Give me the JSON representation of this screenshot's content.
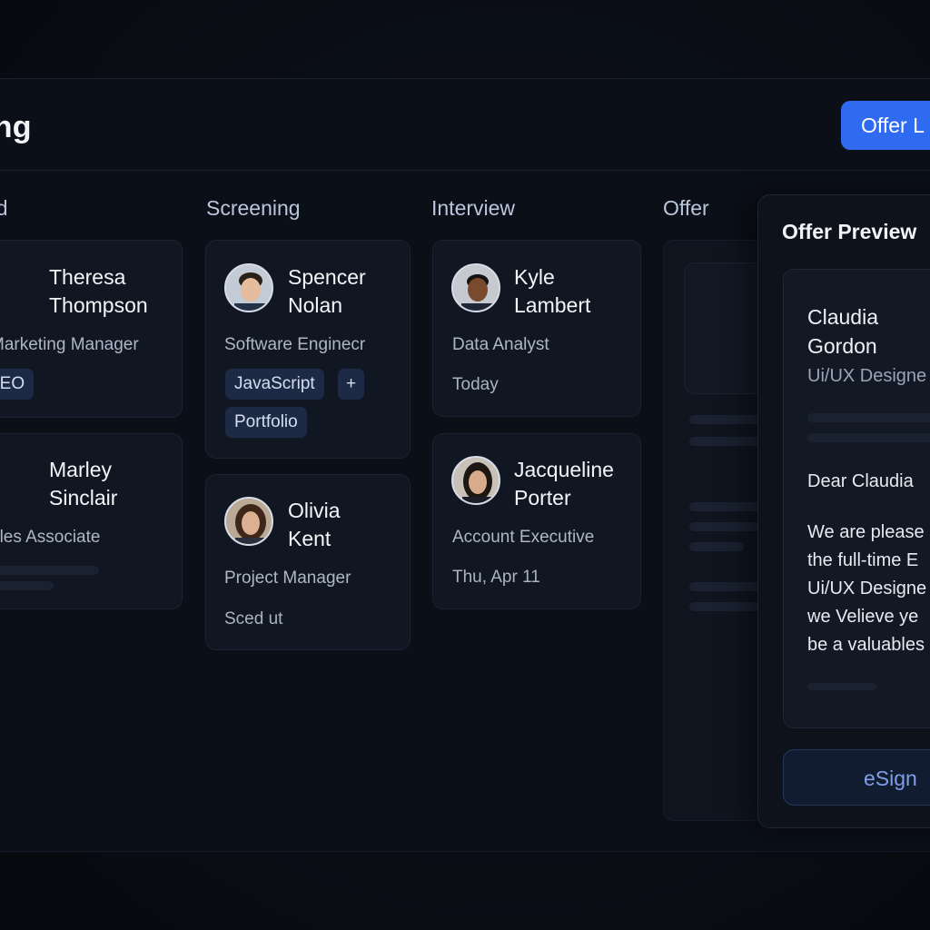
{
  "header": {
    "title": "iring",
    "offer_button": "Offer L"
  },
  "columns": [
    {
      "title": "plied"
    },
    {
      "title": "Screening"
    },
    {
      "title": "Interview"
    },
    {
      "title": "Offer"
    }
  ],
  "cards": {
    "applied": [
      {
        "name_line1": "Theresa",
        "name_line2": "Thompson",
        "role": "Marketing Manager",
        "tag": "SEO"
      },
      {
        "name_line1": "Marley",
        "name_line2": "Sinclair",
        "role": "ales Associate"
      }
    ],
    "screening": [
      {
        "name_line1": "Spencer",
        "name_line2": "Nolan",
        "role": "Software Enginecr",
        "tags": [
          "JavaScript",
          "+",
          "Portfolio"
        ]
      },
      {
        "name_line1": "Olivia",
        "name_line2": "Kent",
        "role": "Project Manager",
        "meta": "Sced ut"
      }
    ],
    "interview": [
      {
        "name_line1": "Kyle",
        "name_line2": "Lambert",
        "role": "Data Analyst",
        "meta": "Today"
      },
      {
        "name_line1": "Jacqueline",
        "name_line2": "Porter",
        "role": "Account Executive",
        "meta": "Thu, Apr 11"
      }
    ]
  },
  "preview": {
    "title": "Offer Preview",
    "candidate_line1": "Claudia",
    "candidate_line2": "Gordon",
    "candidate_role": "Ui/UX Designe",
    "greeting": "Dear Claudia",
    "body": [
      "We are please",
      "the full-time E",
      "Ui/UX Designe",
      "we Velieve ye",
      "be a valuables"
    ],
    "esign_button": "eSign"
  }
}
